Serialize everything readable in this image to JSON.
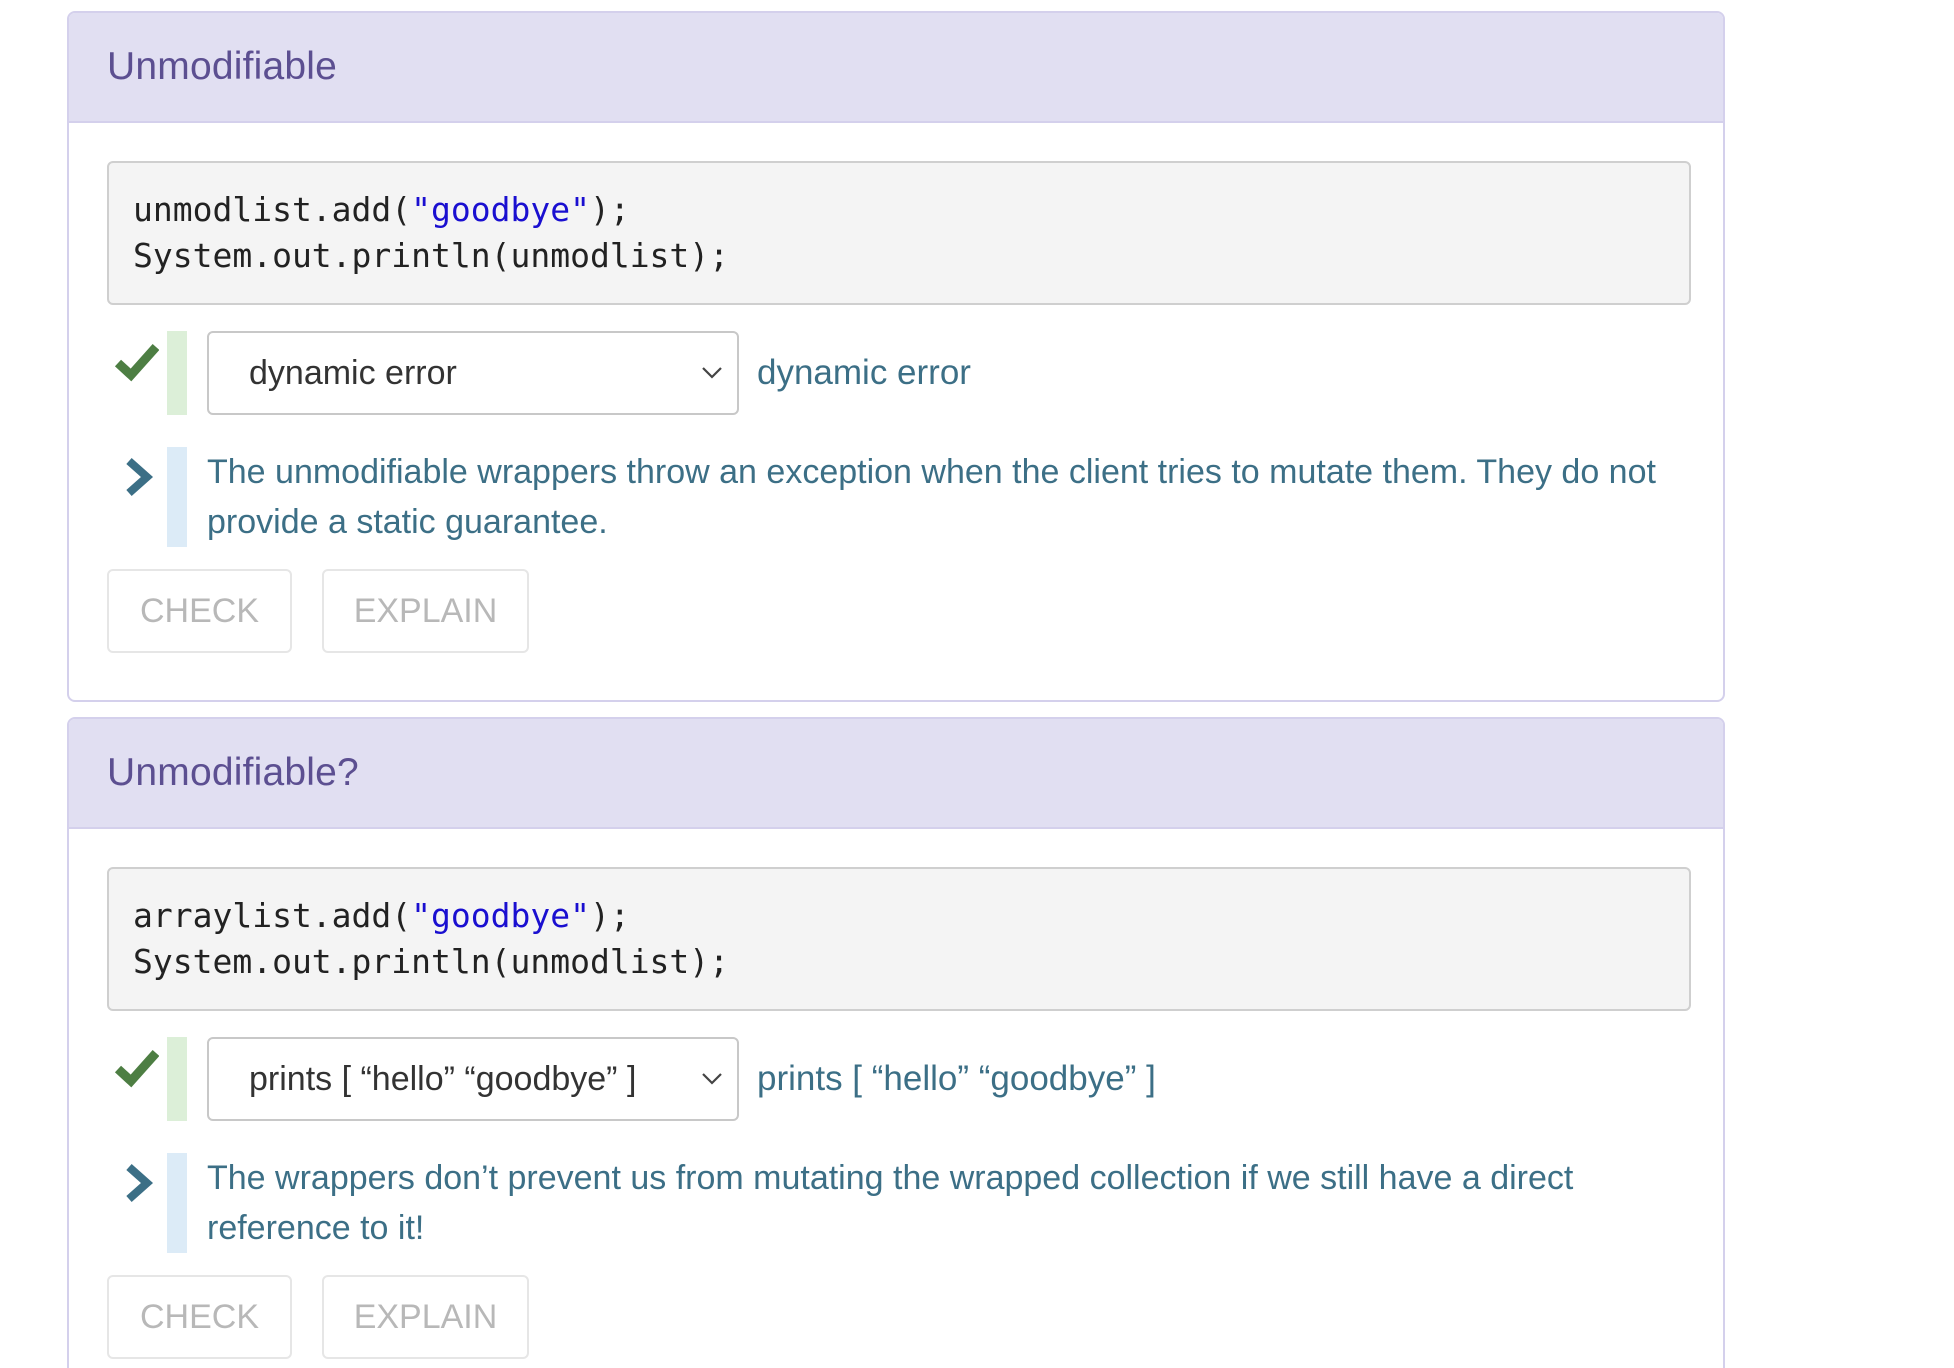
{
  "colors": {
    "header_bg": "#e1dff2",
    "title": "#5c4f91",
    "answer_text": "#3c6f86",
    "check": "#4d7e43",
    "string_literal": "#1a0fd0"
  },
  "icons": {
    "correct": "checkmark-icon",
    "expand": "chevron-right-icon",
    "dropdown": "chevron-down-icon"
  },
  "questions": [
    {
      "title": "Unmodifiable",
      "code": {
        "line1_pre": "unmodlist.add(",
        "line1_str": "\"goodbye\"",
        "line1_post": ");",
        "line2": "System.out.println(unmodlist);"
      },
      "selected_option": "dynamic error",
      "answer": "dynamic error",
      "explanation": "The unmodifiable wrappers throw an exception when the client tries to mutate them. They do not provide a static guarantee.",
      "check_label": "CHECK",
      "explain_label": "EXPLAIN"
    },
    {
      "title": "Unmodifiable?",
      "code": {
        "line1_pre": "arraylist.add(",
        "line1_str": "\"goodbye\"",
        "line1_post": ");",
        "line2": "System.out.println(unmodlist);"
      },
      "selected_option": "prints [ “hello” “goodbye” ]",
      "answer": "prints [ “hello” “goodbye” ]",
      "explanation": "The wrappers don’t prevent us from mutating the wrapped collection if we still have a direct reference to it!",
      "check_label": "CHECK",
      "explain_label": "EXPLAIN"
    }
  ]
}
